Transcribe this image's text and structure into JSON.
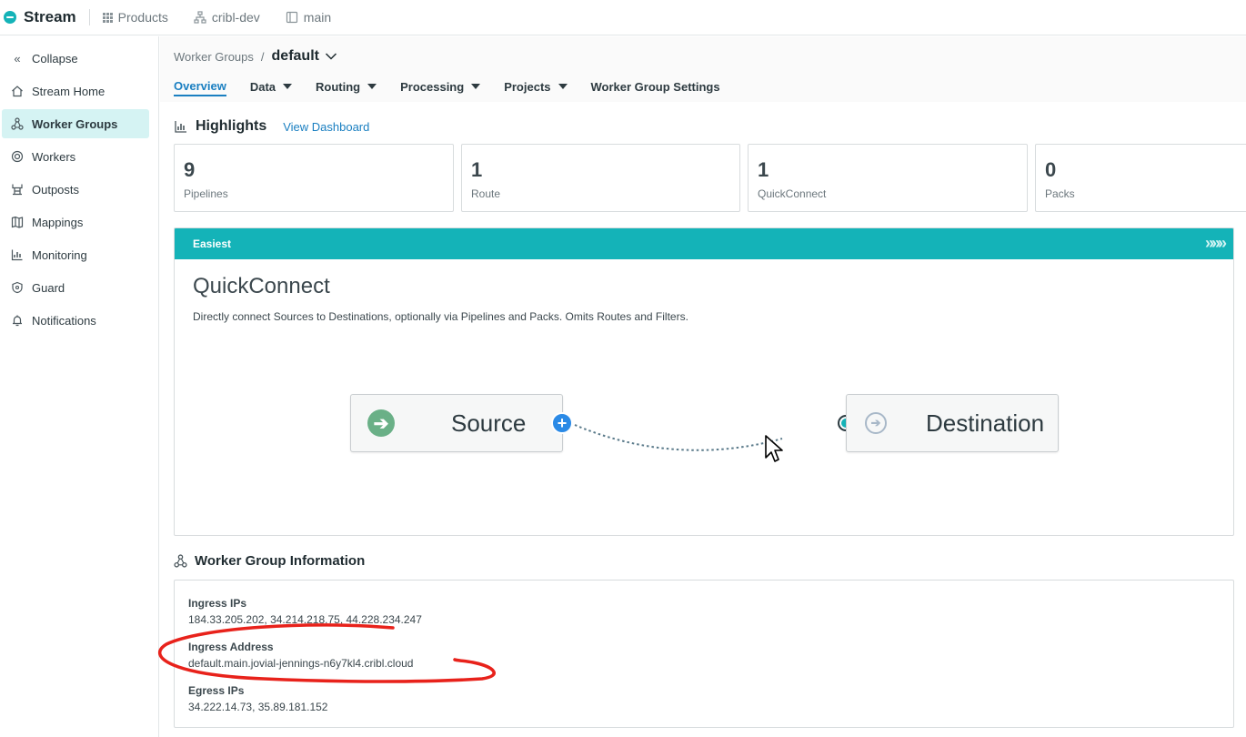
{
  "topbar": {
    "brand": "Stream",
    "products": "Products",
    "org": "cribl-dev",
    "workspace": "main"
  },
  "sidebar": {
    "items": [
      {
        "label": "Collapse",
        "icon": "double-chevron-left-icon"
      },
      {
        "label": "Stream Home",
        "icon": "home-icon"
      },
      {
        "label": "Worker Groups",
        "icon": "worker-groups-icon",
        "active": true
      },
      {
        "label": "Workers",
        "icon": "workers-icon"
      },
      {
        "label": "Outposts",
        "icon": "outposts-icon"
      },
      {
        "label": "Mappings",
        "icon": "map-icon"
      },
      {
        "label": "Monitoring",
        "icon": "monitoring-icon"
      },
      {
        "label": "Guard",
        "icon": "shield-icon"
      },
      {
        "label": "Notifications",
        "icon": "bell-icon"
      }
    ]
  },
  "header": {
    "breadcrumb_root": "Worker Groups",
    "breadcrumb_sep": "/",
    "current_group": "default",
    "tabs": [
      {
        "label": "Overview",
        "active": true
      },
      {
        "label": "Data",
        "dropdown": true
      },
      {
        "label": "Routing",
        "dropdown": true
      },
      {
        "label": "Processing",
        "dropdown": true
      },
      {
        "label": "Projects",
        "dropdown": true
      },
      {
        "label": "Worker Group Settings"
      }
    ]
  },
  "highlights": {
    "title": "Highlights",
    "link": "View Dashboard",
    "stats": [
      {
        "value": "9",
        "label": "Pipelines"
      },
      {
        "value": "1",
        "label": "Route"
      },
      {
        "value": "1",
        "label": "QuickConnect"
      },
      {
        "value": "0",
        "label": "Packs"
      }
    ]
  },
  "quickconnect": {
    "band": "Easiest",
    "band_chevrons": "»»»",
    "title": "QuickConnect",
    "description": "Directly connect Sources to Destinations, optionally via Pipelines and Packs. Omits Routes and Filters.",
    "source_label": "Source",
    "destination_label": "Destination"
  },
  "worker_group_info": {
    "title": "Worker Group Information",
    "ingress_ips_label": "Ingress IPs",
    "ingress_ips_value": "184.33.205.202,  34.214.218.75,  44.228.234.247",
    "ingress_address_label": "Ingress Address",
    "ingress_address_value": "default.main.jovial-jennings-n6y7kl4.cribl.cloud",
    "egress_ips_label": "Egress IPs",
    "egress_ips_value": "34.222.14.73,  35.89.181.152"
  },
  "colors": {
    "accent": "#14b3b8",
    "link": "#1a7fc1",
    "annotation": "#e8221b"
  }
}
